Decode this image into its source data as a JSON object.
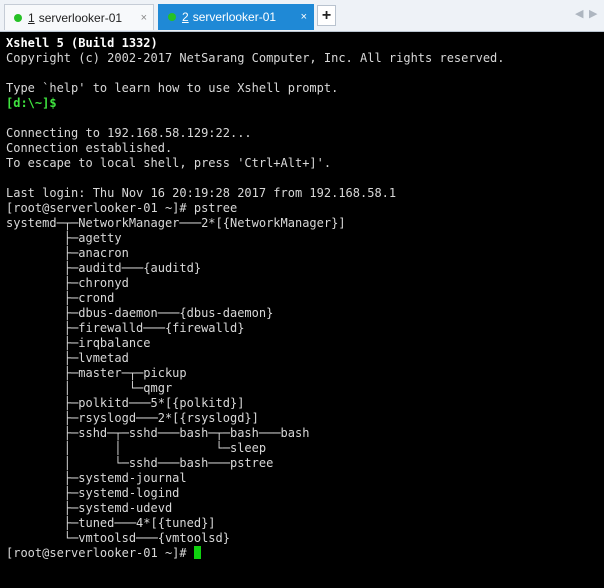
{
  "tabs": [
    {
      "number": "1",
      "label": "serverlooker-01",
      "close": "×"
    },
    {
      "number": "2",
      "label": "serverlooker-01",
      "close": "×"
    }
  ],
  "add_tab": "+",
  "nav": {
    "prev": "◀",
    "next": "▶"
  },
  "colors": {
    "terminal_bg": "#000000",
    "terminal_text": "#d8d8d8",
    "active_tab": "#1f89d6",
    "status_dot": "#26c126",
    "prompt_green": "#3fe33f",
    "cursor": "#0fd20f"
  },
  "terminal": {
    "header_title": "Xshell 5 (Build 1332)",
    "copyright": "Copyright (c) 2002-2017 NetSarang Computer, Inc. All rights reserved.",
    "help_hint": "Type `help' to learn how to use Xshell prompt.",
    "local_prompt": "[d:\\~]$",
    "connecting": "Connecting to 192.168.58.129:22...",
    "established": "Connection established.",
    "escape_hint": "To escape to local shell, press 'Ctrl+Alt+]'.",
    "last_login": "Last login: Thu Nov 16 20:19:28 2017 from 192.168.58.1",
    "command_line": "[root@serverlooker-01 ~]# pstree",
    "pstree": [
      "systemd─┬─NetworkManager───2*[{NetworkManager}]",
      "        ├─agetty",
      "        ├─anacron",
      "        ├─auditd───{auditd}",
      "        ├─chronyd",
      "        ├─crond",
      "        ├─dbus-daemon───{dbus-daemon}",
      "        ├─firewalld───{firewalld}",
      "        ├─irqbalance",
      "        ├─lvmetad",
      "        ├─master─┬─pickup",
      "        │        └─qmgr",
      "        ├─polkitd───5*[{polkitd}]",
      "        ├─rsyslogd───2*[{rsyslogd}]",
      "        ├─sshd─┬─sshd───bash─┬─bash───bash",
      "        │      │             └─sleep",
      "        │      └─sshd───bash───pstree",
      "        ├─systemd-journal",
      "        ├─systemd-logind",
      "        ├─systemd-udevd",
      "        ├─tuned───4*[{tuned}]",
      "        └─vmtoolsd───{vmtoolsd}"
    ],
    "final_prompt": "[root@serverlooker-01 ~]# "
  }
}
